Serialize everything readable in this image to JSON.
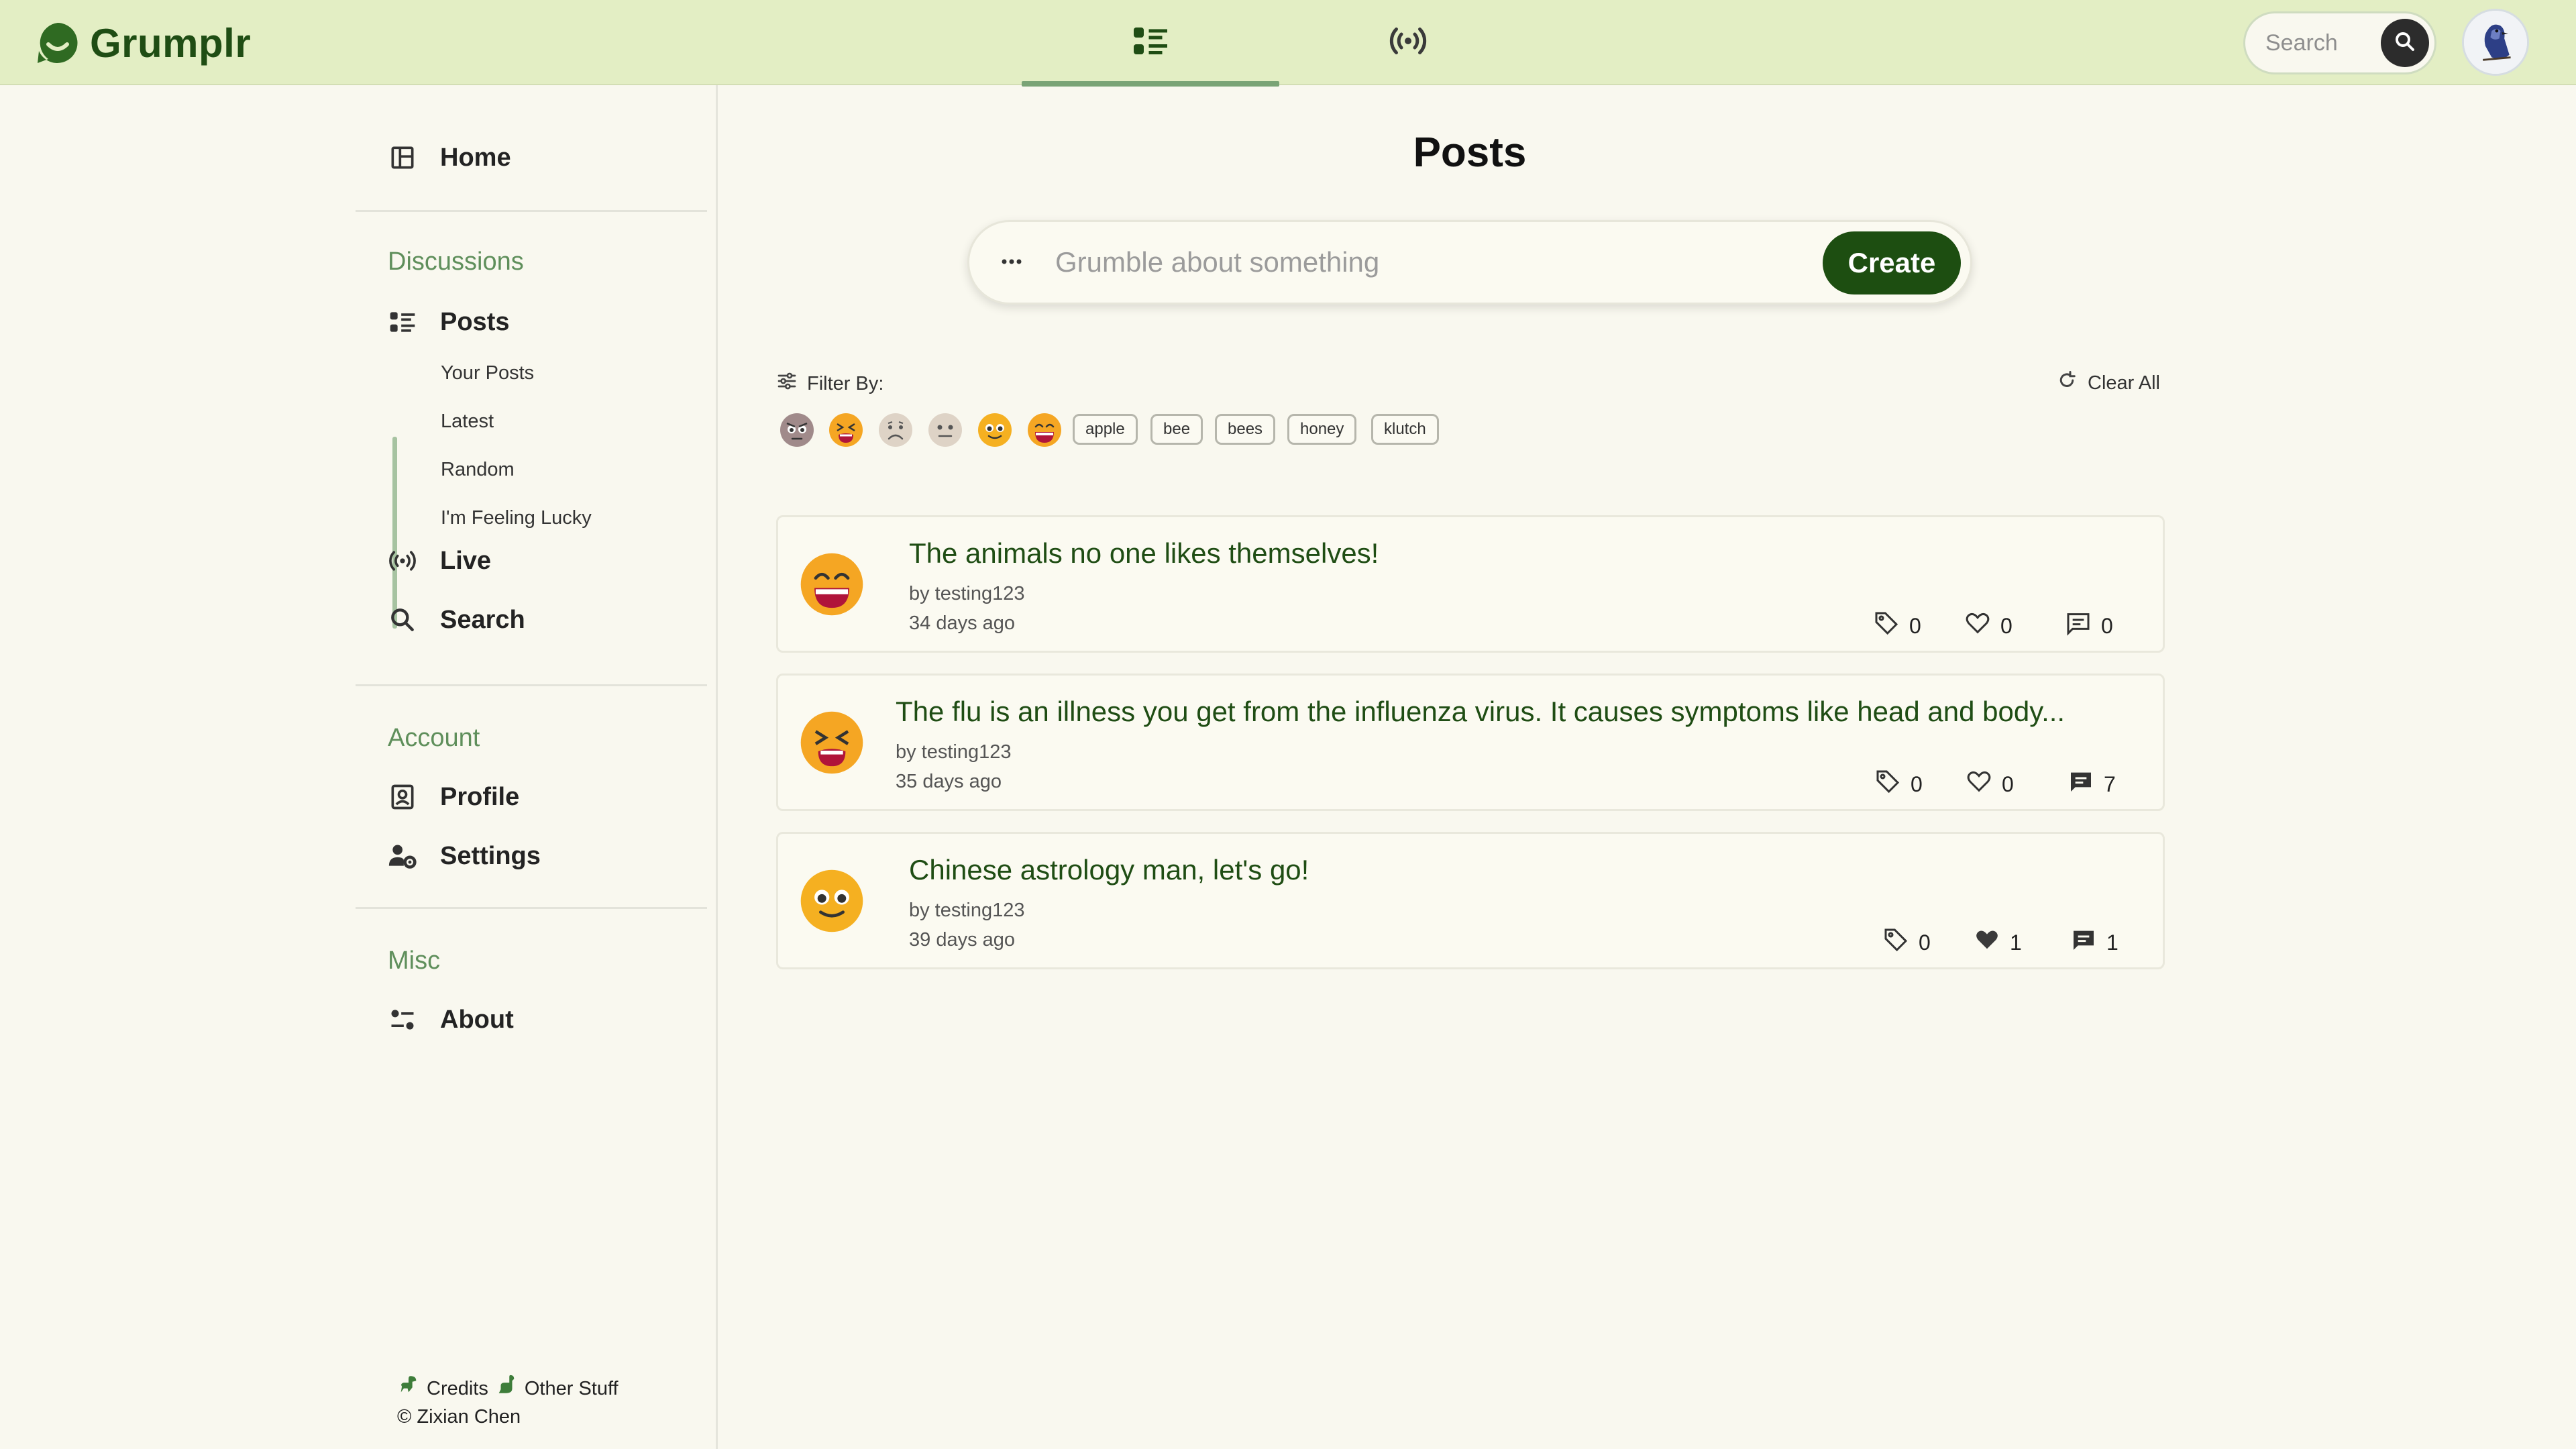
{
  "app": {
    "name": "Grumplr",
    "brand_color": "#1f4d14",
    "topbar_color": "#e3eec4",
    "accent_color": "#7aa476"
  },
  "header": {
    "tabs": [
      {
        "icon": "posts-list-icon",
        "active": true
      },
      {
        "icon": "live-broadcast-icon",
        "active": false
      }
    ],
    "search": {
      "placeholder": "Search"
    }
  },
  "sidebar": {
    "home": "Home",
    "sections": {
      "discussions": "Discussions",
      "account": "Account",
      "misc": "Misc"
    },
    "posts": "Posts",
    "sub_items": [
      "Your Posts",
      "Latest",
      "Random",
      "I'm Feeling Lucky"
    ],
    "live": "Live",
    "search": "Search",
    "profile": "Profile",
    "settings": "Settings",
    "about": "About",
    "footer": {
      "credits": "Credits",
      "other": "Other Stuff",
      "copyright": "© Zixian Chen"
    }
  },
  "main": {
    "title": "Posts",
    "composer": {
      "placeholder": "Grumble about something",
      "create_label": "Create"
    },
    "filter": {
      "label": "Filter By:",
      "clear_label": "Clear All",
      "moods": [
        "angry-face-icon",
        "tired-face-icon",
        "frowning-face-icon",
        "neutral-face-icon",
        "pleading-face-icon",
        "grinning-face-icon"
      ],
      "tags": [
        "apple",
        "bee",
        "bees",
        "honey",
        "klutch"
      ]
    },
    "posts": [
      {
        "mood": "grinning-face-icon",
        "title": "The animals no one likes themselves!",
        "author": "by testing123",
        "age": "34 days ago",
        "tags": "0",
        "likes": "0",
        "comments": "0",
        "liked": false
      },
      {
        "mood": "tired-face-icon",
        "title": "The flu is an illness you get from the influenza virus. It causes symptoms like head and body...",
        "author": "by testing123",
        "age": "35 days ago",
        "tags": "0",
        "likes": "0",
        "comments": "7",
        "liked": false
      },
      {
        "mood": "pleading-face-icon",
        "title": "Chinese astrology man, let's go!",
        "author": "by testing123",
        "age": "39 days ago",
        "tags": "0",
        "likes": "1",
        "comments": "1",
        "liked": true
      }
    ]
  }
}
